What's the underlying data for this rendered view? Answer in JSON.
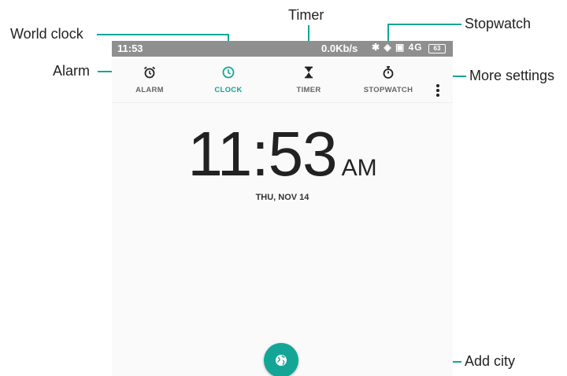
{
  "status_bar": {
    "time": "11:53",
    "network_speed": "0.0Kb/s",
    "icons": "✱ ◈ ▣ 4G",
    "battery": "63"
  },
  "tabs": [
    {
      "label": "ALARM",
      "icon": "alarm-clock-icon",
      "active": false
    },
    {
      "label": "CLOCK",
      "icon": "clock-icon",
      "active": true
    },
    {
      "label": "TIMER",
      "icon": "hourglass-icon",
      "active": false
    },
    {
      "label": "STOPWATCH",
      "icon": "stopwatch-icon",
      "active": false
    }
  ],
  "more_settings_icon": "more-vert-icon",
  "clock": {
    "time": "11:53",
    "ampm": "AM",
    "date": "THU, NOV 14"
  },
  "fab_icon": "globe-icon",
  "callouts": {
    "world_clock": "World clock",
    "timer": "Timer",
    "stopwatch": "Stopwatch",
    "alarm": "Alarm",
    "more_settings": "More settings",
    "add_city": "Add city"
  },
  "colors": {
    "accent": "#13a696",
    "status_bar": "#8f8f8f",
    "callout_line": "#13a696"
  }
}
